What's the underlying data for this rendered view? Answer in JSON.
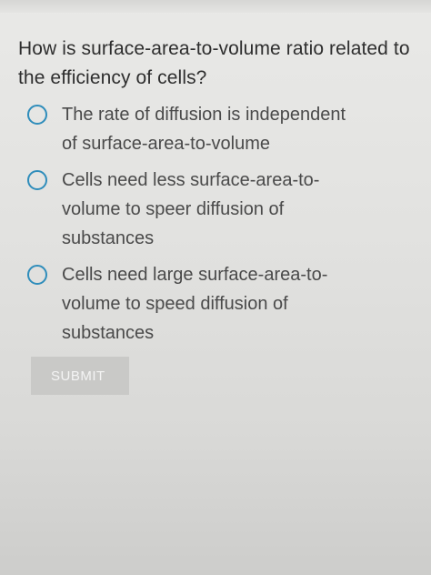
{
  "question": "How is surface-area-to-volume ratio related to the efficiency of cells?",
  "options": [
    {
      "label": "The rate of diffusion is independent of surface-area-to-volume"
    },
    {
      "label": "Cells need less surface-area-to-volume to speer diffusion of substances"
    },
    {
      "label": "Cells need large surface-area-to-volume to speed diffusion of substances"
    }
  ],
  "submit_label": "SUBMIT",
  "colors": {
    "radio": "#2f8dbb",
    "button": "#c9c9c7"
  }
}
